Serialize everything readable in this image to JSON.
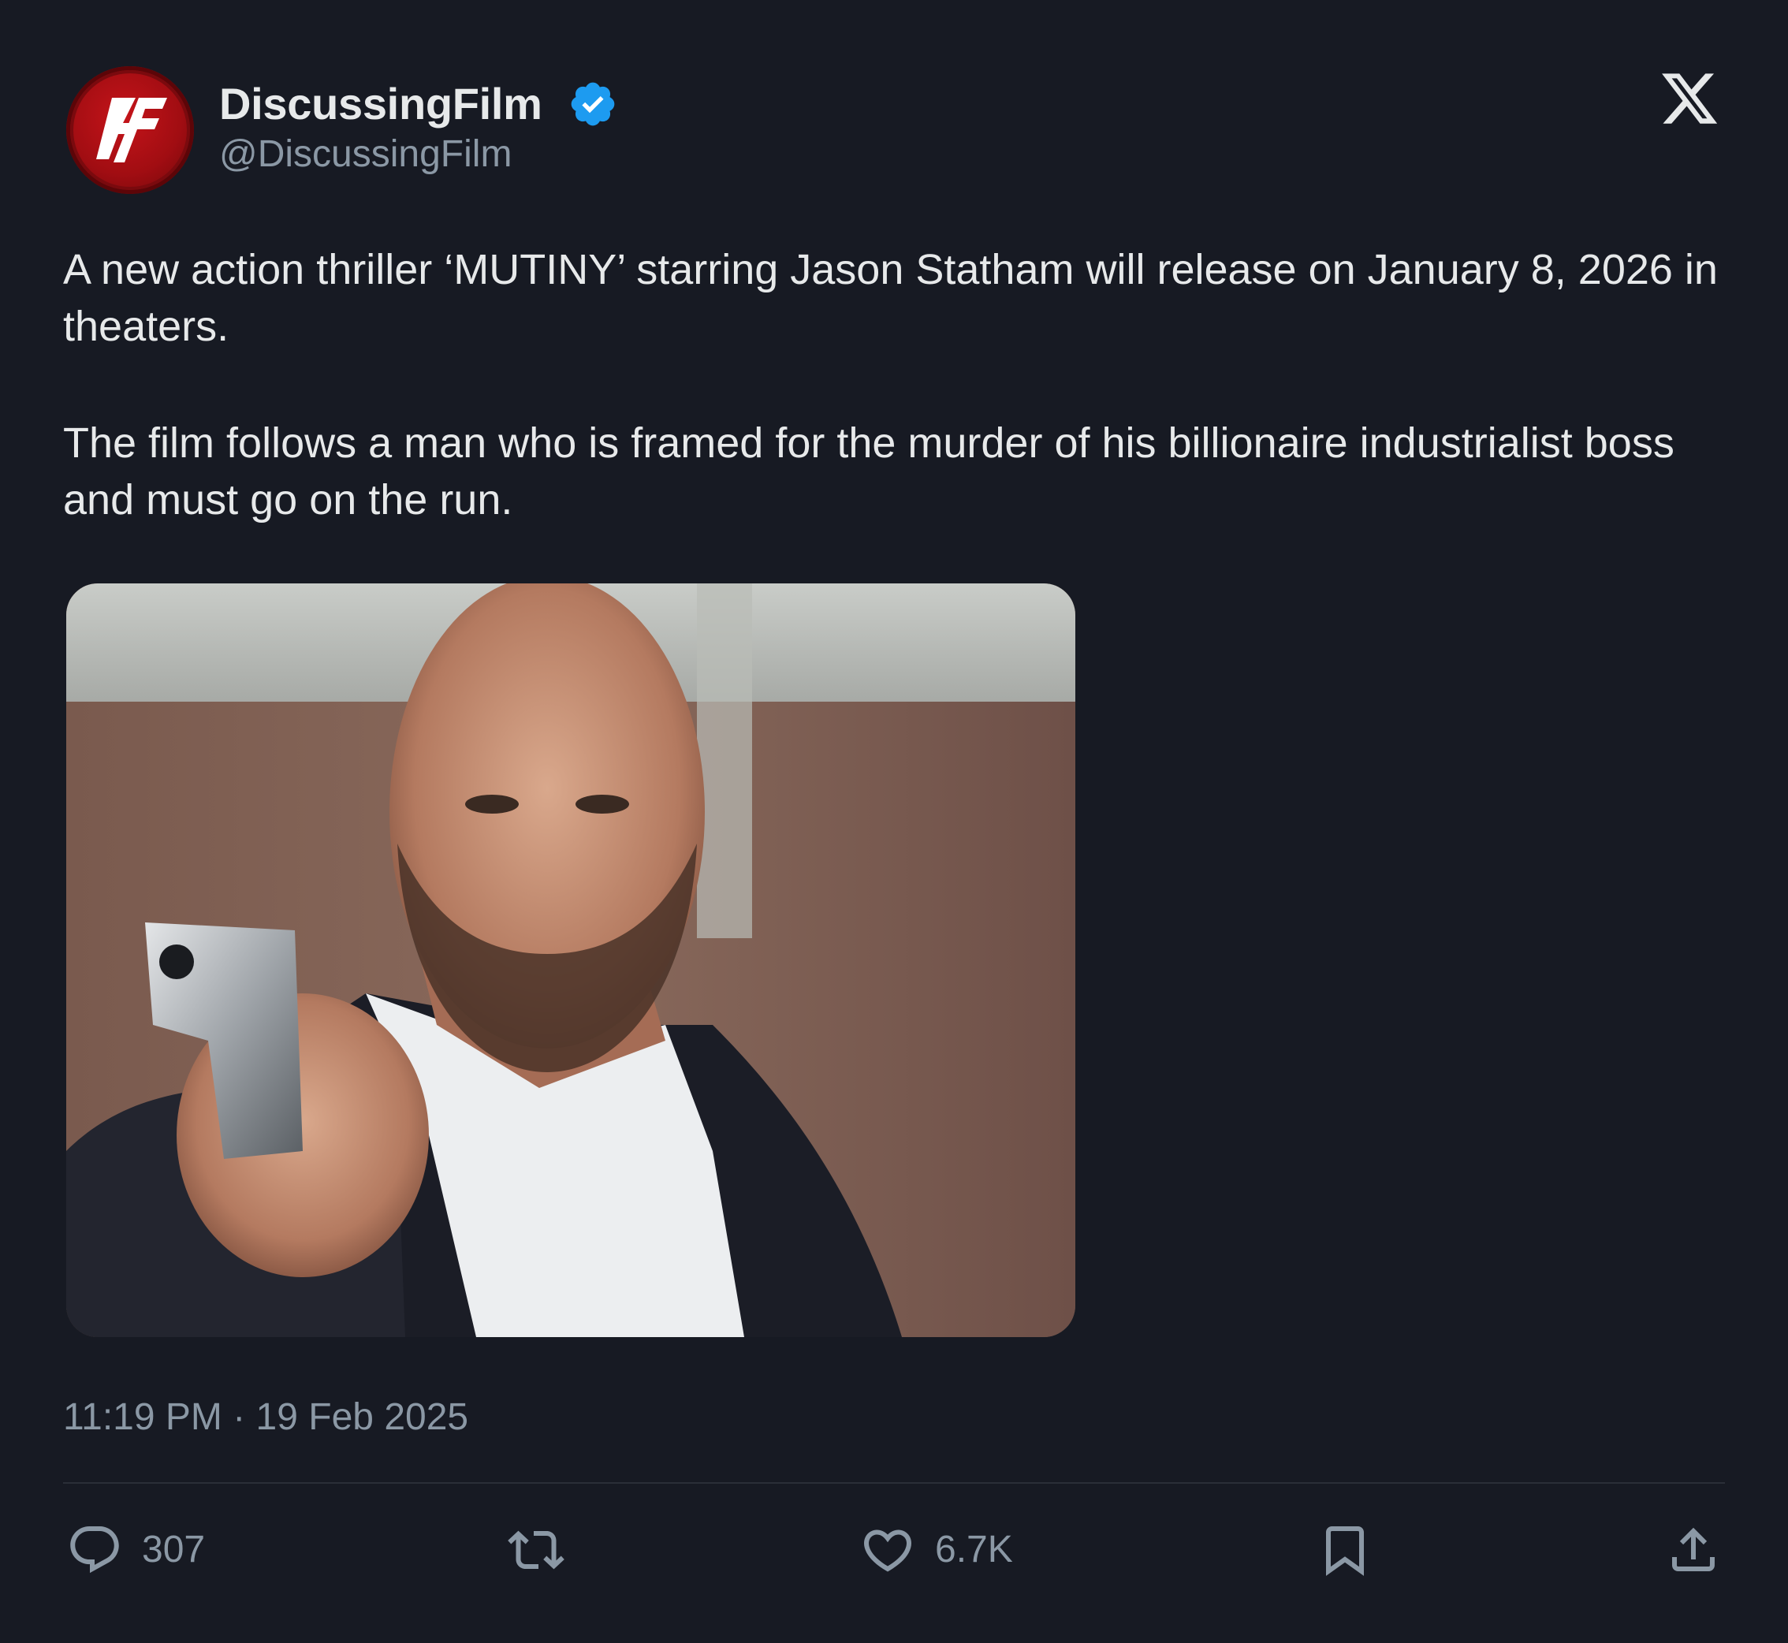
{
  "author": {
    "display_name": "DiscussingFilm",
    "handle": "@DiscussingFilm",
    "verified": true,
    "avatar_icon": "discussingfilm-logo-icon",
    "avatar_logo_text": "DF",
    "avatar_color": "#b0101a"
  },
  "platform": {
    "logo_icon": "x-logo-icon"
  },
  "tweet": {
    "paragraphs": [
      "A new action thriller ‘MUTINY’ starring Jason Statham will release on January 8, 2026 in theaters.",
      "The film follows a man who is framed for the murder of his billionaire industrialist boss and must go on the run."
    ],
    "media_description_icon": "photo",
    "timestamp": "11:19 PM · 19 Feb 2025"
  },
  "actions": {
    "reply": {
      "icon": "reply-icon",
      "count": "307"
    },
    "retweet": {
      "icon": "retweet-icon",
      "count": ""
    },
    "like": {
      "icon": "heart-icon",
      "count": "6.7K"
    },
    "bookmark": {
      "icon": "bookmark-icon",
      "count": ""
    },
    "share": {
      "icon": "share-icon",
      "count": ""
    }
  },
  "colors": {
    "background": "#171a23",
    "text_primary": "#e7e9ea",
    "text_secondary": "#8b98a5",
    "verified_blue": "#1d9bf0",
    "divider": "#2a2f38"
  }
}
